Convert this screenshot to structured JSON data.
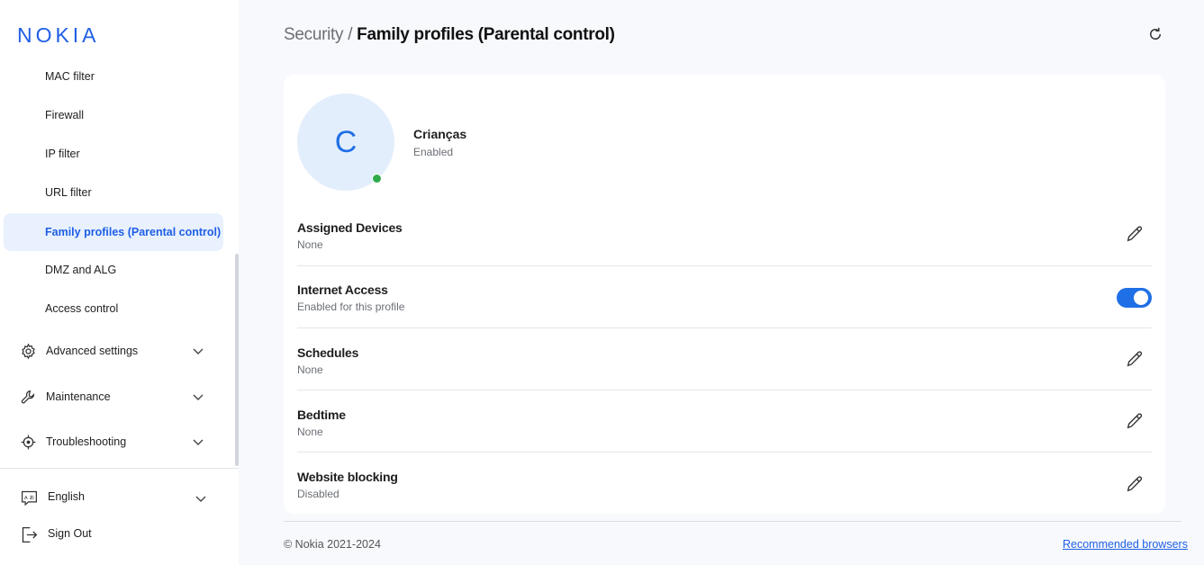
{
  "brand": {
    "logo_text": "NOKIA",
    "color": "#1f5ee6"
  },
  "sidebar": {
    "sub_items": [
      {
        "label": "MAC filter",
        "active": false
      },
      {
        "label": "Firewall",
        "active": false
      },
      {
        "label": "IP filter",
        "active": false
      },
      {
        "label": "URL filter",
        "active": false
      },
      {
        "label": "Family profiles (Parental control)",
        "active": true
      },
      {
        "label": "DMZ and ALG",
        "active": false
      },
      {
        "label": "Access control",
        "active": false
      }
    ],
    "groups": [
      {
        "label": "Advanced settings",
        "icon": "gear-icon"
      },
      {
        "label": "Maintenance",
        "icon": "wrench-icon"
      },
      {
        "label": "Troubleshooting",
        "icon": "crosshair-icon"
      }
    ],
    "language": {
      "label": "English",
      "icon": "translate-icon"
    },
    "sign_out": {
      "label": "Sign Out",
      "icon": "sign-out-icon"
    }
  },
  "header": {
    "parent": "Security",
    "separator": " / ",
    "current": "Family profiles (Parental control)"
  },
  "profile": {
    "initial": "C",
    "name": "Crianças",
    "status": "Enabled",
    "status_color": "#2faa4a"
  },
  "rows": {
    "assigned_devices": {
      "title": "Assigned Devices",
      "value": "None"
    },
    "internet_access": {
      "title": "Internet Access",
      "value": "Enabled for this profile",
      "toggle_on": true
    },
    "schedules": {
      "title": "Schedules",
      "value": "None"
    },
    "bedtime": {
      "title": "Bedtime",
      "value": "None"
    },
    "website_blocking": {
      "title": "Website blocking",
      "value": "Disabled"
    }
  },
  "footer": {
    "copyright": "© Nokia 2021-2024",
    "link": "Recommended browsers"
  }
}
